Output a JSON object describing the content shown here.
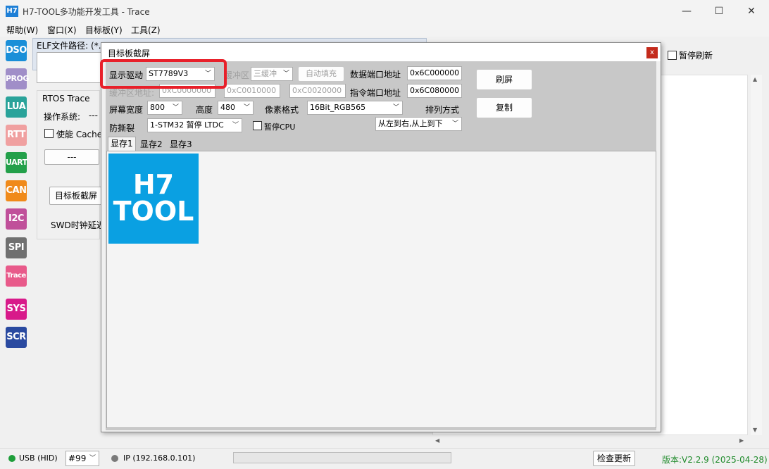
{
  "window": {
    "app_icon_text": "H7",
    "title": "H7-TOOL多功能开发工具 - Trace",
    "minimize": "—",
    "maximize": "☐",
    "close": "✕"
  },
  "menu": [
    "帮助(W)",
    "窗口(X)",
    "目标板(Y)",
    "工具(Z)"
  ],
  "toolbar": [
    {
      "label": "DSO",
      "color": "#1a8fd8"
    },
    {
      "label": "PROG",
      "color": "#a08ec8"
    },
    {
      "label": "LUA",
      "color": "#2aa39a"
    },
    {
      "label": "RTT",
      "color": "#f0a0a0"
    },
    {
      "label": "UART",
      "color": "#23a04a"
    },
    {
      "label": "CAN",
      "color": "#f08a1a"
    },
    {
      "label": "I2C",
      "color": "#c0509a"
    },
    {
      "label": "SPI",
      "color": "#707070"
    },
    {
      "label": "Trace",
      "color": "#e85a8a"
    },
    {
      "label": "SYS",
      "color": "#d81a8a"
    },
    {
      "label": "SCR",
      "color": "#2a4aa0"
    }
  ],
  "main": {
    "elf_label": "ELF文件路径: (*.",
    "rtos_title": "RTOS Trace",
    "os_label": "操作系统:",
    "os_value": "---",
    "enable_cache": "使能 Cache",
    "dash_button": "---",
    "target_screen_button": "目标板截屏",
    "swd_label": "SWD时钟延迟",
    "pause_refresh": "暂停刷新"
  },
  "dialog": {
    "title": "目标板截屏",
    "close": "x",
    "display_driver_label": "显示驱动",
    "display_driver_value": "ST7789V3",
    "buffer_label": "缓冲区",
    "buffer_value": "三缓冲",
    "auto_fill": "自动填充",
    "data_port_label": "数据端口地址",
    "data_port_value": "0x6C000000",
    "refresh_button": "刷屏",
    "buffer_addr_label": "缓冲区地址:",
    "buffer_addr1": "0xC0000000",
    "buffer_addr2": "0xC0010000",
    "buffer_addr3": "0xC0020000",
    "cmd_port_label": "指令端口地址",
    "cmd_port_value": "0x6C080000",
    "copy_button": "复制",
    "width_label": "屏幕宽度",
    "width_value": "800",
    "height_label": "高度",
    "height_value": "480",
    "pixel_format_label": "像素格式",
    "pixel_format_value": "16Bit_RGB565",
    "order_label": "排列方式",
    "order_value": "从左到右,从上到下",
    "anti_tear_label": "防撕裂",
    "anti_tear_value": "1-STM32 暂停 LTDC",
    "pause_cpu": "暂停CPU",
    "tabs": [
      "显存1",
      "显存2",
      "显存3"
    ],
    "logo_line1": "H7",
    "logo_line2": "TOOL"
  },
  "status": {
    "usb": "USB (HID)",
    "usb_color": "#1e9e3a",
    "device_id": "#99",
    "ip": "IP (192.168.0.101)",
    "check_update": "检查更新",
    "version": "版本:V2.2.9 (2025-04-28)",
    "version_color": "#1e8a2a"
  }
}
